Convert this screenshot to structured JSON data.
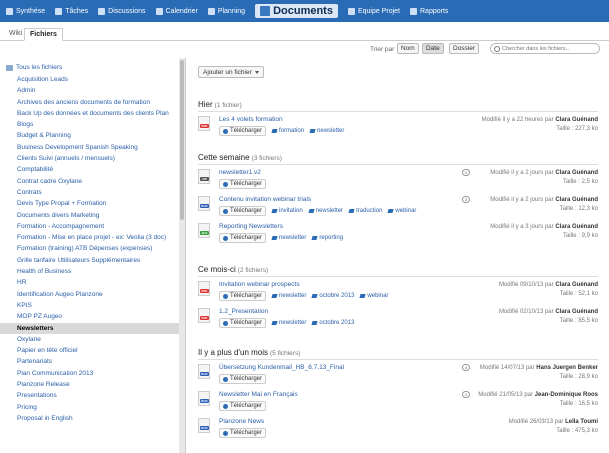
{
  "nav": [
    {
      "label": "Synthèse",
      "icon": "home-icon"
    },
    {
      "label": "Tâches",
      "icon": "tasks-icon"
    },
    {
      "label": "Discussions",
      "icon": "discussions-icon"
    },
    {
      "label": "Calendrier",
      "icon": "calendar-icon"
    },
    {
      "label": "Planning",
      "icon": "planning-icon"
    },
    {
      "label": "Documents",
      "icon": "documents-icon",
      "active": true
    },
    {
      "label": "Equipe Projet",
      "icon": "team-icon"
    },
    {
      "label": "Rapports",
      "icon": "reports-icon"
    }
  ],
  "tabs": {
    "wiki": "Wiki",
    "files": "Fichiers"
  },
  "toolbar": {
    "sort_label": "Trier par",
    "sort_name": "Nom",
    "sort_date": "Date",
    "sort_folder": "Dossier",
    "search_placeholder": "Chercher dans les fichiers..."
  },
  "sidebar": {
    "root_label": "Tous les fichiers",
    "folders": [
      "Acquisition Leads",
      "Admin",
      "Archives des anciens documents de formation",
      "Back Up des données et documents des clients Plan",
      "Blogs",
      "Budget & Planning",
      "Business Development Spanish Speaking",
      "Clients Suivi (annuels / mensuels)",
      "Comptabilité",
      "Contrat cadre Oxylane",
      "Contrats",
      "Devis Type Propal + Formation",
      "Documents divers Marketing",
      "Formation - Accompagnement",
      "Formation - Mise en place projet - ex: Veolia (3 doc)",
      "Formation (training) ATB Dépenses (expenses)",
      "Grille tarifaire Utilisateurs Supplémentaires",
      "Health of Business",
      "HR",
      "Identification Augeo Planzone",
      "KPIS",
      "MOP PZ Augeo",
      "Newsletters",
      "Oxylane",
      "Papier en tête officiel",
      "Partenariats",
      "Plan Communication 2013",
      "Planzone Release",
      "Presentations",
      "Pricing",
      "Proposal in English"
    ],
    "selected_index": 22
  },
  "main": {
    "add_file_label": "Ajouter un fichier",
    "download_label": "Télécharger",
    "sections": [
      {
        "title": "Hier",
        "count": "(1 fichier)",
        "files": [
          {
            "name": "Les 4 volets formation",
            "type": "pdf",
            "type_label": "PDF",
            "tags": [
              "formation",
              "newsletter"
            ],
            "modified": "Modifié il y a 22 heures par",
            "author": "Clara Guénand",
            "size": "Taille : 227,3 ko",
            "comments": ""
          }
        ]
      },
      {
        "title": "Cette semaine",
        "count": "(3 fichiers)",
        "files": [
          {
            "name": "newsletter1.v2",
            "type": "zip",
            "type_label": "ZIP",
            "tags": [],
            "modified": "Modifié il y a 2 jours par",
            "author": "Clara Guénand",
            "size": "Taille : 2,5 ko",
            "comments": "1"
          },
          {
            "name": "Contenu invitation webinar trials",
            "type": "doc",
            "type_label": "DOC",
            "tags": [
              "invitation",
              "newsletter",
              "traduction",
              "webinar"
            ],
            "modified": "Modifié il y a 2 jours par",
            "author": "Clara Guénand",
            "size": "Taille : 12,3 ko",
            "comments": "3"
          },
          {
            "name": "Reporting Newsletters",
            "type": "xls",
            "type_label": "XLS",
            "tags": [
              "newsletter",
              "reporting"
            ],
            "modified": "Modifié il y a 3 jours par",
            "author": "Clara Guénand",
            "size": "Taille : 9,9 ko",
            "comments": ""
          }
        ]
      },
      {
        "title": "Ce mois-ci",
        "count": "(2 fichiers)",
        "files": [
          {
            "name": "Invitation webinar prospects",
            "type": "pdf",
            "type_label": "PDF",
            "tags": [
              "newsletter",
              "octobre 2013",
              "webinar"
            ],
            "modified": "Modifié 09/10/13 par",
            "author": "Clara Guénand",
            "size": "Taille : 52,1 ko",
            "comments": ""
          },
          {
            "name": "1.2_Presentation",
            "type": "pdf",
            "type_label": "PDF",
            "tags": [
              "newsletter",
              "octobre 2013"
            ],
            "modified": "Modifié 02/10/13 par",
            "author": "Clara Guénand",
            "size": "Taille : 85,5 ko",
            "comments": ""
          }
        ]
      },
      {
        "title": "Il y a plus d'un mois",
        "count": "(5 fichiers)",
        "files": [
          {
            "name": "Übersetzung Kundenmail_HB_6.7.13_Final",
            "type": "doc",
            "type_label": "DOC",
            "tags": [],
            "modified": "Modifié 14/07/13 par",
            "author": "Hans Juergen Benker",
            "size": "Taille : 28,9 ko",
            "comments": "4"
          },
          {
            "name": "Newsletter Mai en Français",
            "type": "doc",
            "type_label": "DOC",
            "tags": [],
            "modified": "Modifié 21/05/13 par",
            "author": "Jean-Dominique Roos",
            "size": "Taille : 16,5 ko",
            "comments": "1"
          },
          {
            "name": "Planzone News",
            "type": "doc",
            "type_label": "DOC",
            "tags": [],
            "modified": "Modifié 26/03/13 par",
            "author": "Leïla Toumi",
            "size": "Taille : 475,3 ko",
            "comments": ""
          }
        ]
      }
    ]
  }
}
